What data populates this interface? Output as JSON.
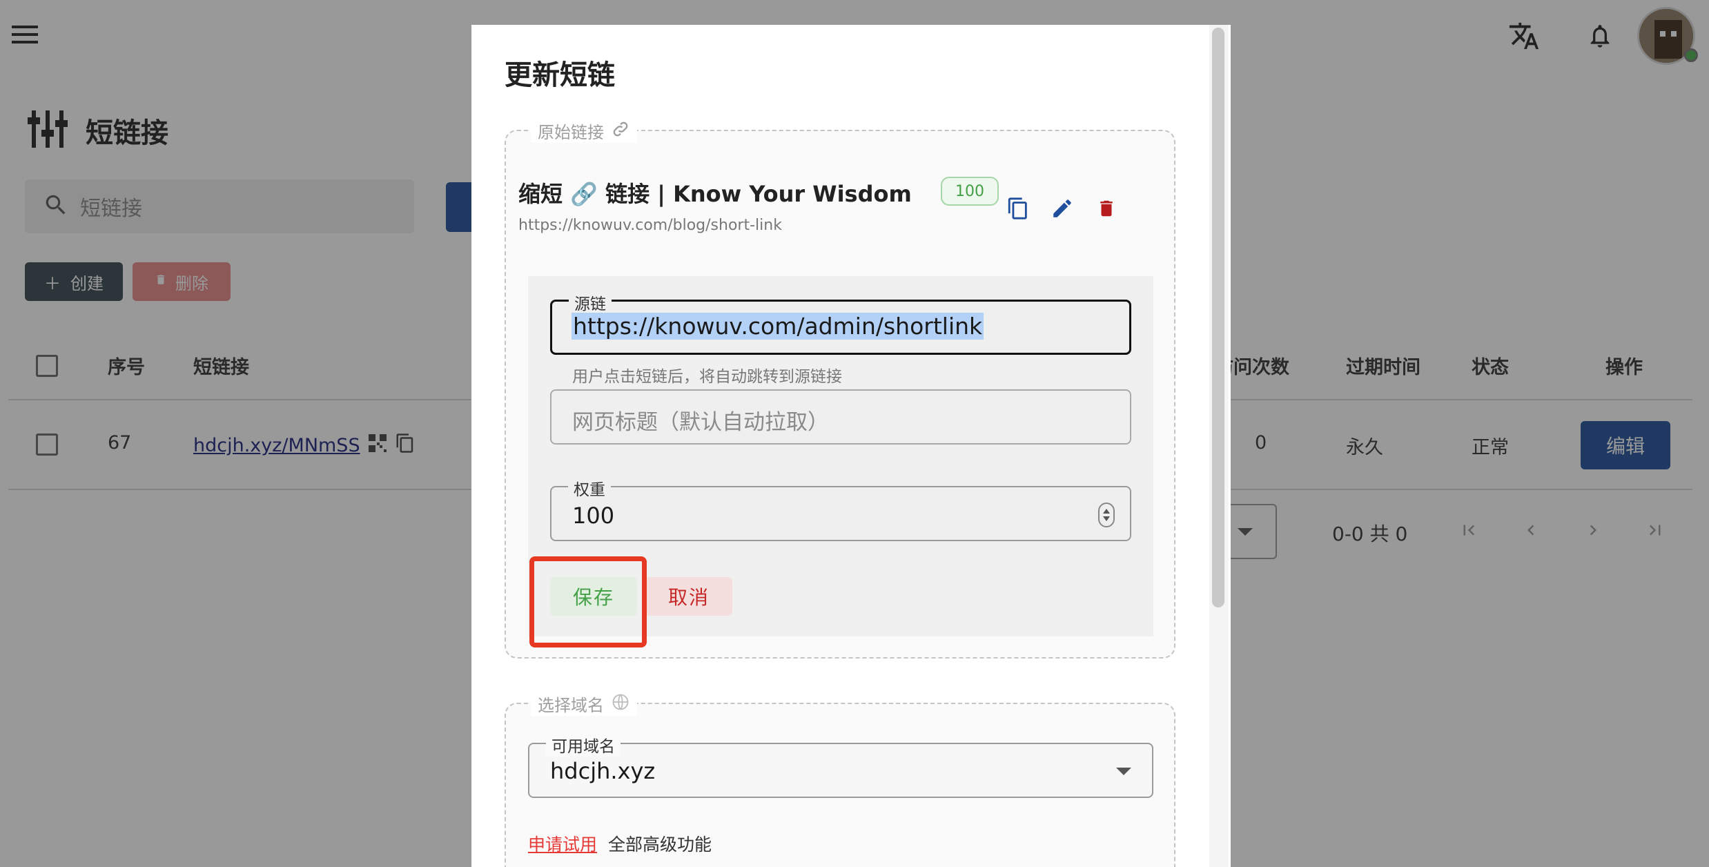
{
  "background": {
    "page_title": "短链接",
    "search_placeholder": "短链接",
    "create_label": "创建",
    "delete_label": "删除",
    "table": {
      "headers": {
        "index": "序号",
        "short_link": "短链接",
        "visits": "访问次数",
        "expire": "过期时间",
        "status": "状态",
        "actions": "操作"
      },
      "rows": [
        {
          "index": "67",
          "short_link": "hdcjh.xyz/MNmSS",
          "visits": "0",
          "expire": "永久",
          "status": "正常",
          "action_label": "编辑"
        }
      ]
    },
    "pagination": {
      "range_text": "0-0 共 0"
    }
  },
  "dialog": {
    "title": "更新短链",
    "origin_section": {
      "legend": "原始链接",
      "link_title": "缩短 🔗 链接 | Know Your Wisdom",
      "weight_badge": "100",
      "link_url": "https://knowuv.com/blog/short-link"
    },
    "form": {
      "source_label": "源链",
      "source_value": "https://knowuv.com/admin/shortlink",
      "source_hint": "用户点击短链后，将自动跳转到源链接",
      "title_placeholder": "网页标题（默认自动拉取）",
      "weight_label": "权重",
      "weight_value": "100",
      "save_label": "保存",
      "cancel_label": "取消"
    },
    "domain_section": {
      "legend": "选择域名",
      "select_label": "可用域名",
      "select_value": "hdcjh.xyz",
      "trial_link": "申请试用",
      "trial_text": "全部高级功能"
    }
  },
  "colors": {
    "primary": "#1f4e9c",
    "save_text": "#43a047",
    "cancel_text": "#c62828",
    "highlight": "#e53922"
  }
}
